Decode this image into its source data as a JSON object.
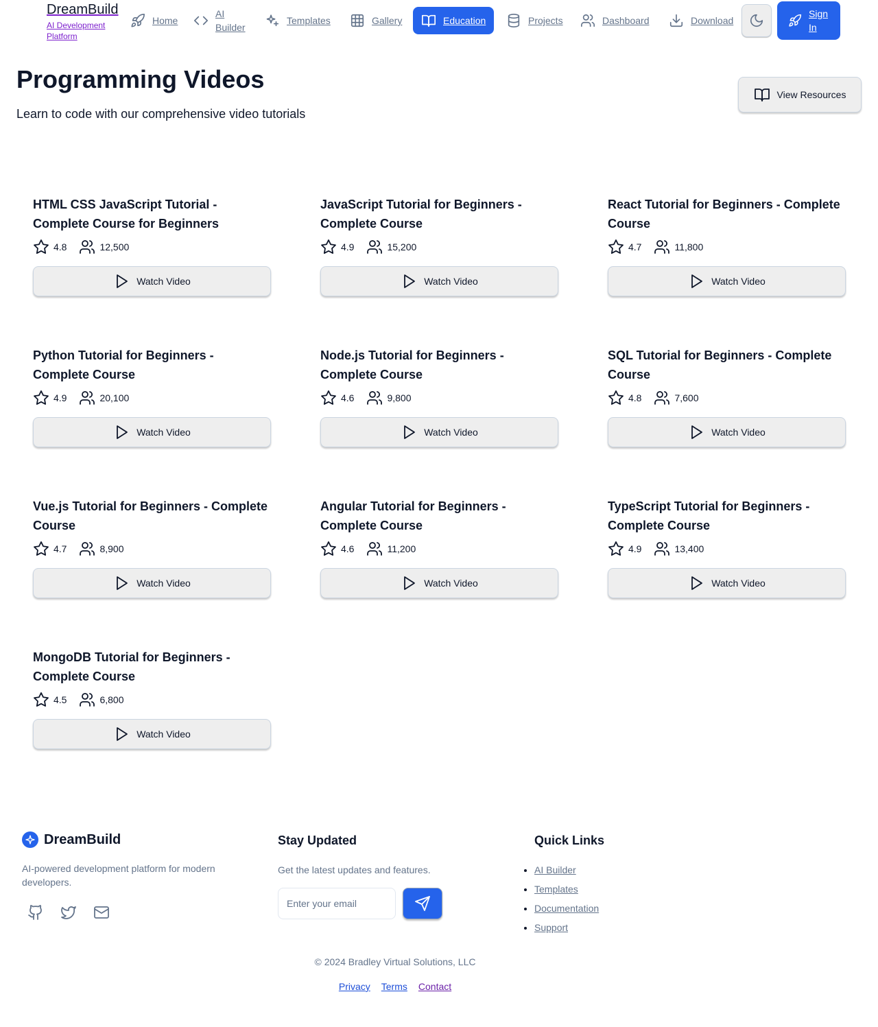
{
  "header": {
    "brand_name": "DreamBuild",
    "brand_tagline": "AI Development Platform",
    "nav": [
      {
        "label": "Home",
        "icon": "rocket-icon"
      },
      {
        "label": "AI Builder",
        "icon": "code-icon"
      },
      {
        "label": "Templates",
        "icon": "sparkles-icon"
      },
      {
        "label": "Gallery",
        "icon": "grid-icon"
      },
      {
        "label": "Education",
        "icon": "book-open-icon",
        "active": true
      },
      {
        "label": "Projects",
        "icon": "database-icon"
      },
      {
        "label": "Dashboard",
        "icon": "users-icon"
      },
      {
        "label": "Download",
        "icon": "download-icon"
      }
    ],
    "theme_toggle_icon": "moon-icon",
    "signin_label": "Sign In"
  },
  "hero": {
    "title": "Programming Videos",
    "subtitle": "Learn to code with our comprehensive video tutorials",
    "resources_label": "View Resources"
  },
  "videos": [
    {
      "title": "HTML CSS JavaScript Tutorial - Complete Course for Beginners",
      "rating": "4.8",
      "students": "12,500",
      "button": "Watch Video"
    },
    {
      "title": "JavaScript Tutorial for Beginners - Complete Course",
      "rating": "4.9",
      "students": "15,200",
      "button": "Watch Video"
    },
    {
      "title": "React Tutorial for Beginners - Complete Course",
      "rating": "4.7",
      "students": "11,800",
      "button": "Watch Video"
    },
    {
      "title": "Python Tutorial for Beginners - Complete Course",
      "rating": "4.9",
      "students": "20,100",
      "button": "Watch Video"
    },
    {
      "title": "Node.js Tutorial for Beginners - Complete Course",
      "rating": "4.6",
      "students": "9,800",
      "button": "Watch Video"
    },
    {
      "title": "SQL Tutorial for Beginners - Complete Course",
      "rating": "4.8",
      "students": "7,600",
      "button": "Watch Video"
    },
    {
      "title": "Vue.js Tutorial for Beginners - Complete Course",
      "rating": "4.7",
      "students": "8,900",
      "button": "Watch Video"
    },
    {
      "title": "Angular Tutorial for Beginners - Complete Course",
      "rating": "4.6",
      "students": "11,200",
      "button": "Watch Video"
    },
    {
      "title": "TypeScript Tutorial for Beginners - Complete Course",
      "rating": "4.9",
      "students": "13,400",
      "button": "Watch Video"
    },
    {
      "title": "MongoDB Tutorial for Beginners - Complete Course",
      "rating": "4.5",
      "students": "6,800",
      "button": "Watch Video"
    }
  ],
  "footer": {
    "brand_name": "DreamBuild",
    "description": "AI-powered development platform for modern developers.",
    "social_icons": [
      "github-icon",
      "twitter-icon",
      "mail-icon"
    ],
    "newsletter_heading": "Stay Updated",
    "newsletter_text": "Get the latest updates and features.",
    "email_placeholder": "Enter your email",
    "quick_links_heading": "Quick Links",
    "quick_links": [
      "AI Builder",
      "Templates",
      "Documentation",
      "Support"
    ],
    "copyright": "© 2024 Bradley Virtual Solutions, LLC",
    "legal_links": [
      {
        "label": "Privacy",
        "color": "#1d4ed8"
      },
      {
        "label": "Terms",
        "color": "#1d4ed8"
      },
      {
        "label": "Contact",
        "color": "#6b21a8"
      }
    ]
  },
  "colors": {
    "accent": "#2563eb",
    "text": "#0f172a",
    "muted": "#64748b",
    "button_bg": "#eeeeee"
  }
}
